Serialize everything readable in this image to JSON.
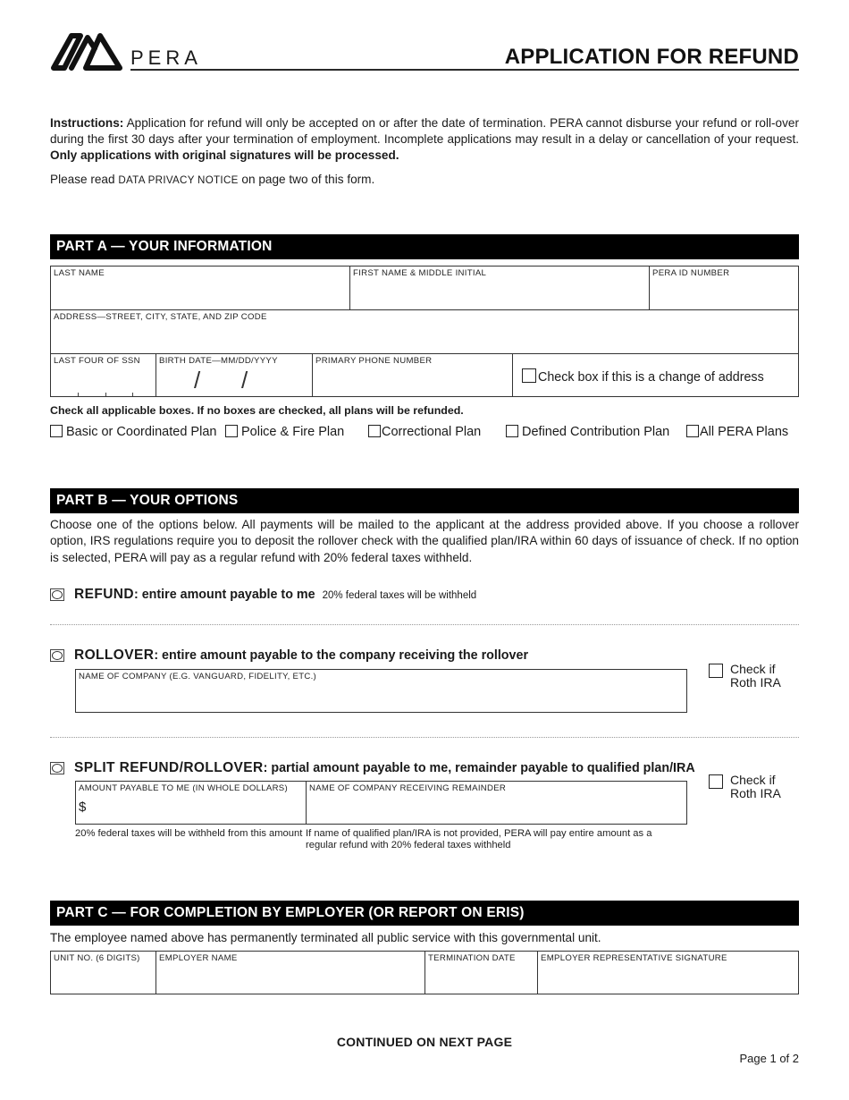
{
  "header": {
    "logo_text": "PERA",
    "title": "APPLICATION FOR REFUND"
  },
  "instructions": {
    "lead": "Instructions:",
    "body": " Application for refund will only be accepted on or after the date of termination. PERA cannot disburse your refund or roll-over during the first 30 days after your termination of employment. Incomplete applications may result in a delay or cancellation of your request. ",
    "emphasis": "Only applications with original signatures will be processed.",
    "privacy_prefix": "Please read ",
    "privacy_link": "DATA PRIVACY NOTICE",
    "privacy_suffix": " on page two of this form."
  },
  "part_a": {
    "title": "PART A — YOUR INFORMATION",
    "fields": {
      "last_name": "LAST NAME",
      "first_name": "FIRST NAME & MIDDLE INITIAL",
      "pera_id": "PERA ID NUMBER",
      "address": "ADDRESS—STREET, CITY, STATE, AND ZIP CODE",
      "ssn": "LAST FOUR OF SSN",
      "birth_date": "BIRTH DATE—MM/DD/YYYY",
      "phone": "PRIMARY PHONE NUMBER",
      "change_address": "Check box if this is a change of address"
    },
    "date_separator": "/",
    "plans_note": "Check all applicable boxes. If no boxes are checked, all plans will be refunded.",
    "plans": [
      {
        "label": "Basic or Coordinated Plan",
        "checked": false
      },
      {
        "label": "Police & Fire Plan",
        "checked": false
      },
      {
        "label": "Correctional Plan",
        "checked": false
      },
      {
        "label": "Defined Contribution Plan",
        "checked": false
      },
      {
        "label": "All PERA Plans",
        "checked": false
      }
    ]
  },
  "part_b": {
    "title": "PART B — YOUR OPTIONS",
    "intro": "Choose one of the options below. All payments will be mailed to the applicant at the address provided above. If you choose a rollover option, IRS regulations require you to deposit the rollover check with the qualified plan/IRA within 60 days of issuance of check. If no option is selected, PERA will pay as a regular refund with 20% federal taxes withheld.",
    "refund": {
      "title": "REFUND",
      "desc": ": entire amount payable to me",
      "note": "20% federal taxes will be withheld",
      "selected": false
    },
    "rollover": {
      "title": "ROLLOVER",
      "desc": ": entire amount payable to the company receiving the rollover",
      "company_label": "NAME OF COMPANY (E.G. VANGUARD, FIDELITY, ETC.)",
      "roth_label_1": "Check if",
      "roth_label_2": "Roth IRA",
      "selected": false
    },
    "split": {
      "title": "SPLIT REFUND/ROLLOVER",
      "desc": ": partial amount payable to me, remainder payable to qualified plan/IRA",
      "amount_label": "AMOUNT PAYABLE TO ME (IN WHOLE DOLLARS)",
      "currency": "$",
      "company_label": "NAME OF COMPANY RECEIVING REMAINDER",
      "amount_note": "20% federal taxes will be withheld from this amount",
      "company_note": "If name of qualified plan/IRA is not provided, PERA will pay entire amount as a regular refund with 20% federal taxes withheld",
      "roth_label_1": "Check if",
      "roth_label_2": "Roth IRA",
      "selected": false
    }
  },
  "part_c": {
    "title": "PART C — FOR COMPLETION BY EMPLOYER (OR REPORT ON ERIS)",
    "statement": "The employee named above has permanently terminated all public service with this governmental unit.",
    "fields": {
      "unit_no": "UNIT NO. (6 DIGITS)",
      "employer_name": "EMPLOYER NAME",
      "termination_date": "TERMINATION DATE",
      "signature": "EMPLOYER REPRESENTATIVE SIGNATURE"
    }
  },
  "footer": {
    "continued": "CONTINUED ON NEXT PAGE",
    "page": "Page 1 of 2"
  }
}
